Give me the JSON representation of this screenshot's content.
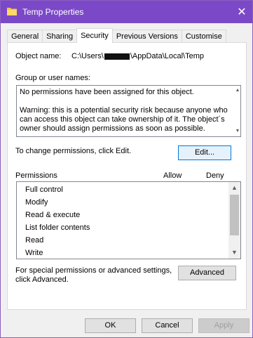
{
  "window": {
    "title": "Temp Properties",
    "close_glyph": "✕",
    "accent": "#7b49c8"
  },
  "tabs": [
    {
      "label": "General"
    },
    {
      "label": "Sharing"
    },
    {
      "label": "Security",
      "active": true
    },
    {
      "label": "Previous Versions"
    },
    {
      "label": "Customise"
    }
  ],
  "security": {
    "object_label": "Object name:",
    "object_path_prefix": "C:\\Users\\",
    "object_path_suffix": "\\AppData\\Local\\Temp",
    "group_label": "Group or user names:",
    "msg_line1": "No permissions have been assigned for this object.",
    "msg_line2": "Warning: this is a potential security risk because anyone who can access this object can take ownership of it. The object´s owner should assign permissions as soon as possible.",
    "change_text": "To change permissions, click Edit.",
    "edit_button": "Edit...",
    "permissions_label": "Permissions",
    "allow_header": "Allow",
    "deny_header": "Deny",
    "permissions": [
      {
        "label": "Full control"
      },
      {
        "label": "Modify"
      },
      {
        "label": "Read & execute"
      },
      {
        "label": "List folder contents"
      },
      {
        "label": "Read"
      },
      {
        "label": "Write"
      }
    ],
    "advanced_text_1": "For special permissions or advanced settings,",
    "advanced_text_2": "click Advanced.",
    "advanced_button": "Advanced"
  },
  "footer": {
    "ok": "OK",
    "cancel": "Cancel",
    "apply": "Apply"
  }
}
